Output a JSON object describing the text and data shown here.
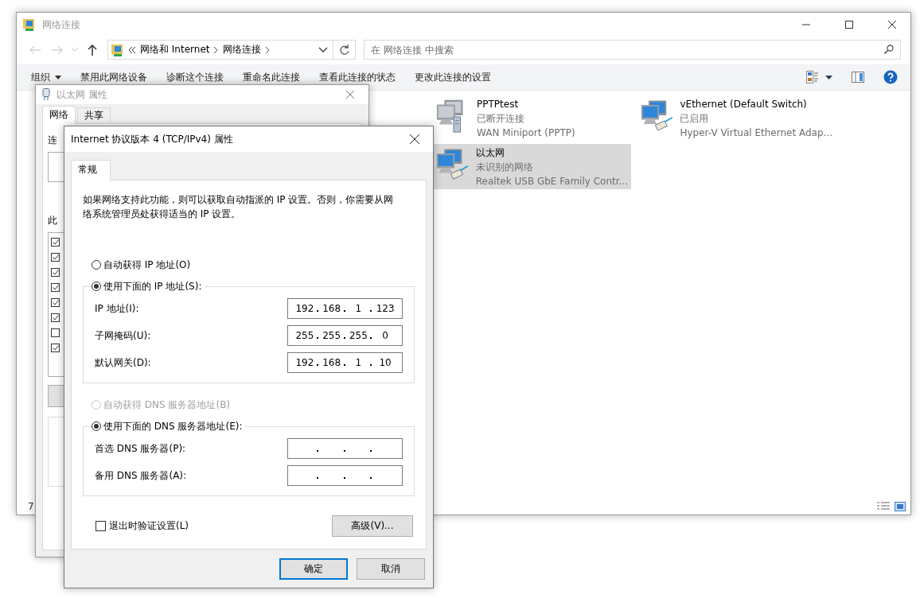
{
  "explorer": {
    "title": "网络连接",
    "breadcrumb": [
      "网络和 Internet",
      "网络连接"
    ],
    "search": {
      "placeholder": "在 网络连接 中搜索"
    },
    "commands": [
      "组织",
      "禁用此网络设备",
      "诊断这个连接",
      "重命名此连接",
      "查看此连接的状态",
      "更改此连接的设置"
    ],
    "connections": [
      {
        "name": "PPTPtest",
        "status": "已断开连接",
        "device": "WAN Miniport (PPTP)",
        "kind": "vpn",
        "selected": false
      },
      {
        "name": "vEthernet (Default Switch)",
        "status": "已启用",
        "device": "Hyper-V Virtual Ethernet Adap...",
        "kind": "ethernet",
        "selected": false
      },
      {
        "name": "以太网",
        "status": "未识别的网络",
        "device": "Realtek USB GbE Family Contr...",
        "kind": "ethernet",
        "selected": true
      }
    ],
    "status_bar": "7"
  },
  "ethernet_properties": {
    "title": "以太网 属性",
    "tabs": [
      {
        "label": "网络",
        "selected": true
      },
      {
        "label": "共享",
        "selected": false
      }
    ],
    "connect_label": "连",
    "list_label": "此",
    "components": [
      {
        "checked": true
      },
      {
        "checked": true
      },
      {
        "checked": true
      },
      {
        "checked": true
      },
      {
        "checked": true
      },
      {
        "checked": true
      },
      {
        "checked": false
      },
      {
        "checked": true
      }
    ]
  },
  "ipv4_properties": {
    "title": "Internet 协议版本 4 (TCP/IPv4) 属性",
    "tabs": [
      {
        "label": "常规",
        "selected": true
      }
    ],
    "description": "如果网络支持此功能，则可以获取自动指派的 IP 设置。否则，你需要从网络系统管理员处获得适当的 IP 设置。",
    "ip_options": [
      {
        "label": "自动获得 IP 地址(O)",
        "selected": false,
        "disabled": false
      },
      {
        "label": "使用下面的 IP 地址(S):",
        "selected": true,
        "disabled": false
      }
    ],
    "ip_fields": [
      {
        "label": "IP 地址(I):",
        "octets": [
          "192",
          "168",
          "1",
          "123"
        ]
      },
      {
        "label": "子网掩码(U):",
        "octets": [
          "255",
          "255",
          "255",
          "0"
        ]
      },
      {
        "label": "默认网关(D):",
        "octets": [
          "192",
          "168",
          "1",
          "10"
        ]
      }
    ],
    "dns_options": [
      {
        "label": "自动获得 DNS 服务器地址(B)",
        "selected": false,
        "disabled": true
      },
      {
        "label": "使用下面的 DNS 服务器地址(E):",
        "selected": true,
        "disabled": false
      }
    ],
    "dns_fields": [
      {
        "label": "首选 DNS 服务器(P):"
      },
      {
        "label": "备用 DNS 服务器(A):"
      }
    ],
    "validate": {
      "label": "退出时验证设置(L)",
      "checked": false
    },
    "advanced_button": "高级(V)...",
    "buttons": [
      {
        "label": "确定",
        "default": true
      },
      {
        "label": "取消",
        "default": false
      }
    ]
  }
}
